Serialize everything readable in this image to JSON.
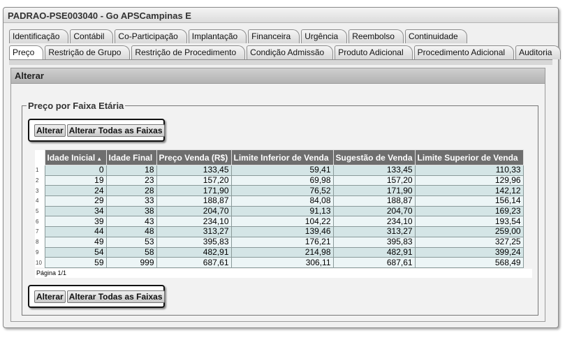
{
  "window": {
    "title": "PADRAO-PSE003040 - Go APSCampinas E"
  },
  "tabs_row1": [
    "Identificação",
    "Contábil",
    "Co-Participação",
    "Implantação",
    "Financeira",
    "Urgência",
    "Reembolso",
    "Continuidade"
  ],
  "tabs_row2": [
    "Preço",
    "Restrição de Grupo",
    "Restrição de Procedimento",
    "Condição Admissão",
    "Produto Adicional",
    "Procedimento Adicional",
    "Auditoria"
  ],
  "active_tab": "Preço",
  "panel": {
    "title": "Alterar"
  },
  "fieldset": {
    "legend": "Preço por Faixa Etária"
  },
  "buttons": {
    "alterar": "Alterar",
    "alterar_todas": "Alterar Todas as Faixas"
  },
  "table": {
    "columns": [
      "Idade Inicial",
      "Idade Final",
      "Preço Venda (R$)",
      "Limite Inferior de Venda",
      "Sugestão de Venda",
      "Limite Superior de Venda"
    ],
    "sorted_column": "Idade Inicial",
    "sort_icon": "sort-ascending-icon",
    "rows": [
      [
        "0",
        "18",
        "133,45",
        "59,41",
        "133,45",
        "110,33"
      ],
      [
        "19",
        "23",
        "157,20",
        "69,98",
        "157,20",
        "129,96"
      ],
      [
        "24",
        "28",
        "171,90",
        "76,52",
        "171,90",
        "142,12"
      ],
      [
        "29",
        "33",
        "188,87",
        "84,08",
        "188,87",
        "156,14"
      ],
      [
        "34",
        "38",
        "204,70",
        "91,13",
        "204,70",
        "169,23"
      ],
      [
        "39",
        "43",
        "234,10",
        "104,22",
        "234,10",
        "193,54"
      ],
      [
        "44",
        "48",
        "313,27",
        "139,46",
        "313,27",
        "259,00"
      ],
      [
        "49",
        "53",
        "395,83",
        "176,21",
        "395,83",
        "327,25"
      ],
      [
        "54",
        "58",
        "482,91",
        "214,98",
        "482,91",
        "399,24"
      ],
      [
        "59",
        "999",
        "687,61",
        "306,11",
        "687,61",
        "568,49"
      ]
    ]
  },
  "pager": {
    "text": "Página 1/1"
  },
  "colors": {
    "header_bg": "#6e6e6e",
    "row_odd": "#d4e5e6",
    "row_even": "#ecf5f6"
  }
}
